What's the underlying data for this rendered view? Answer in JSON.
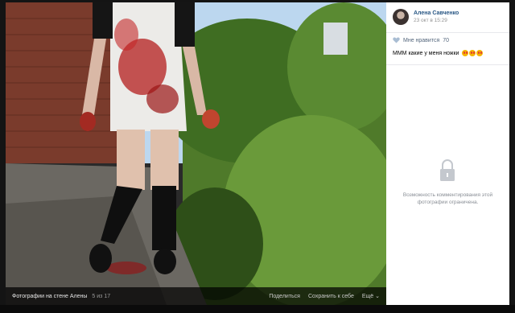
{
  "photo_bar": {
    "album_title": "Фотографии на стене Алены",
    "counter": "5 из 17",
    "share_label": "Поделиться",
    "save_label": "Сохранить к себе",
    "more_label": "Ещё"
  },
  "post": {
    "author_name": "Алена Савченко",
    "date": "23 окт в 15:29",
    "likes_label": "Мне нравится",
    "likes_count": "70",
    "caption": "МММ какие у меня ножки",
    "caption_emoji": "heart-eyes-emoji"
  },
  "comments": {
    "restricted_note": "Возможность комментирования этой фотографии ограничена."
  },
  "colors": {
    "link_blue": "#2a5885",
    "bar_bg": "#000000",
    "panel_bg": "#ffffff",
    "muted": "#939393"
  }
}
